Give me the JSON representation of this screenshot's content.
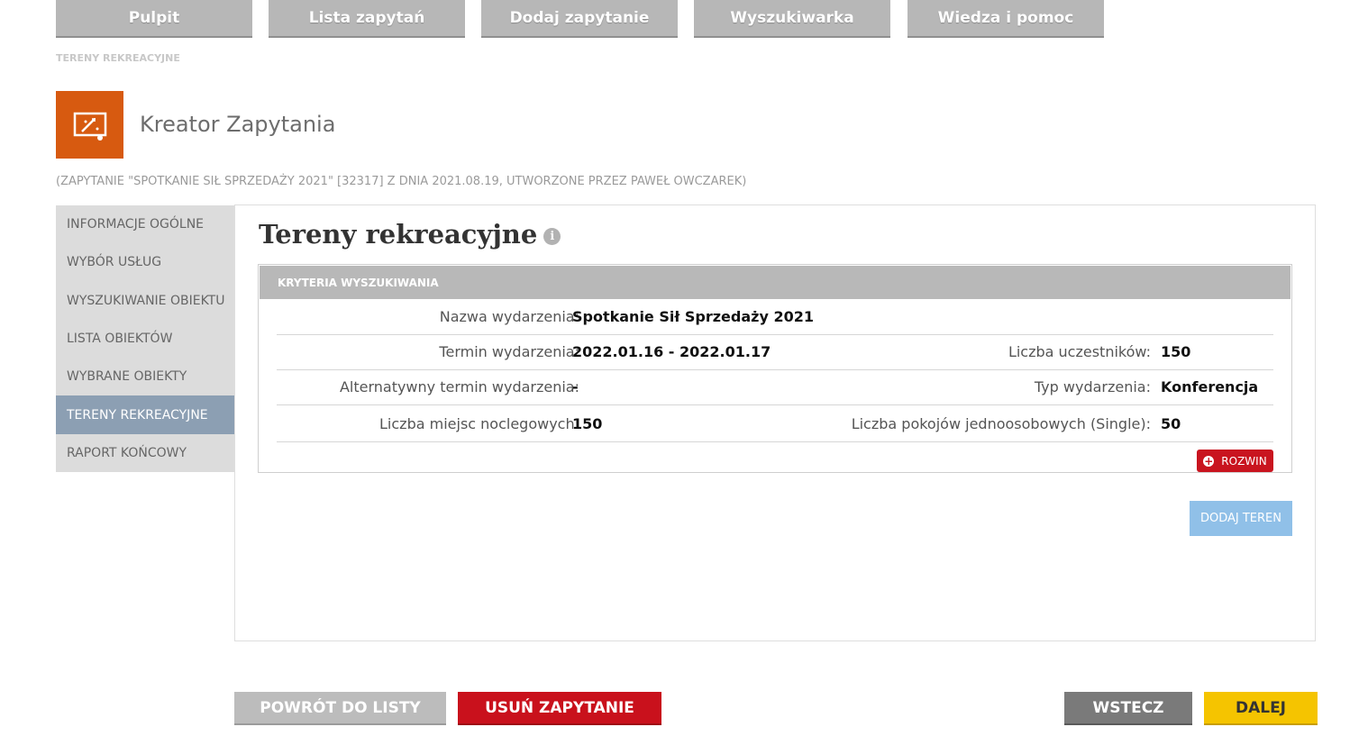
{
  "nav": [
    "Pulpit",
    "Lista zapytań",
    "Dodaj zapytanie",
    "Wyszukiwarka",
    "Wiedza i pomoc"
  ],
  "breadcrumb": "TERENY REKREACYJNE",
  "app": {
    "title": "Kreator Zapytania",
    "icon": "wand-screen-icon"
  },
  "subinfo": "(ZAPYTANIE \"SPOTKANIE SIŁ SPRZEDAŻY 2021\" [32317] Z DNIA 2021.08.19, UTWORZONE PRZEZ PAWEŁ OWCZAREK)",
  "sidebar": {
    "items": [
      "INFORMACJE OGÓLNE",
      "WYBÓR USŁUG",
      "WYSZUKIWANIE OBIEKTU",
      "LISTA OBIEKTÓW",
      "WYBRANE OBIEKTY",
      "TERENY REKREACYJNE",
      "RAPORT KOŃCOWY"
    ],
    "active": "TERENY REKREACYJNE"
  },
  "panel": {
    "title": "Tereny rekreacyjne",
    "criteria": {
      "header": "KRYTERIA WYSZUKIWANIA",
      "rows": [
        {
          "left_label": "Nazwa wydarzenia:",
          "left_value": "Spotkanie Sił Sprzedaży 2021",
          "right_label": "",
          "right_value": ""
        },
        {
          "left_label": "Termin wydarzenia:",
          "left_value": "2022.01.16 - 2022.01.17",
          "right_label": "Liczba uczestników:",
          "right_value": "150"
        },
        {
          "left_label": "Alternatywny termin wydarzenia:",
          "left_value": "-",
          "right_label": "Typ wydarzenia:",
          "right_value": "Konferencja"
        },
        {
          "left_label": "Liczba miejsc noclegowych:",
          "left_value": "150",
          "right_label": "Liczba pokojów jednoosobowych (Single):",
          "right_value": "50"
        }
      ],
      "expand_label": "ROZWIN"
    },
    "add_button": "DODAJ TEREN"
  },
  "footer": {
    "back_to_list": "POWRÓT DO LISTY",
    "delete": "USUŃ ZAPYTANIE",
    "previous": "WSTECZ",
    "next": "DALEJ"
  },
  "colors": {
    "nav": "#b7b7b7",
    "icon_bg": "#d75a10",
    "sidebar_active": "#8c9fb3",
    "expand": "#c9141f",
    "add": "#90c0e8",
    "delete": "#c9111c",
    "previous": "#7a7a7a",
    "next": "#f5c400"
  }
}
